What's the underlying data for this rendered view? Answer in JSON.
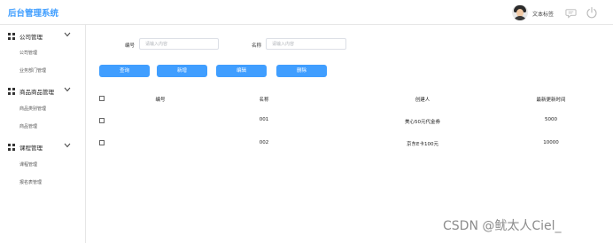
{
  "header": {
    "title": "后台管理系统",
    "username": "文本标签"
  },
  "sidebar": {
    "groups": [
      {
        "label": "公司管理",
        "items": [
          "公司管理",
          "业务部门管理"
        ]
      },
      {
        "label": "商品商品管理",
        "items": [
          "商品类别管理",
          "商品管理"
        ]
      },
      {
        "label": "课程管理",
        "items": [
          "课程管理",
          "报名表管理"
        ]
      }
    ]
  },
  "search": {
    "field1_label": "编号",
    "field1_placeholder": "请输入内容",
    "field2_label": "名称",
    "field2_placeholder": "请输入内容"
  },
  "buttons": {
    "query": "查询",
    "add": "新增",
    "edit": "编辑",
    "delete": "删除"
  },
  "table": {
    "headers": [
      "编号",
      "名称",
      "创建人",
      "最新更新时间"
    ],
    "rows": [
      [
        "",
        "001",
        "美心50元代金券",
        "5000"
      ],
      [
        "",
        "002",
        "京东E卡100元",
        "10000"
      ]
    ]
  },
  "watermark": "CSDN @鱿太人Ciel_"
}
